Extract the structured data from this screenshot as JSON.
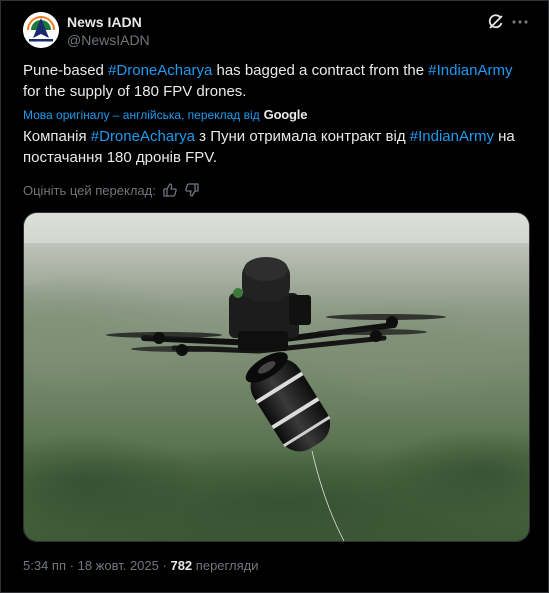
{
  "author": {
    "name": "News IADN",
    "handle": "@NewsIADN"
  },
  "icons": {
    "grok": "grok-icon",
    "more": "more-dots-icon",
    "thumb_up": "thumb-up-icon",
    "thumb_down": "thumb-down-icon"
  },
  "tweet": {
    "part1": "Pune-based ",
    "hashtag1": "#DroneAcharya",
    "part2": " has bagged a contract from the ",
    "hashtag2": "#IndianArmy",
    "part3": " for the supply of 180 FPV drones."
  },
  "translation": {
    "note": "Мова оригіналу – англійська, переклад від",
    "provider": "Google",
    "part1": "Компанія ",
    "hashtag1": "#DroneAcharya",
    "part2": " з Пуни отримала контракт від ",
    "hashtag2": "#IndianArmy",
    "part3": " на постачання 180 дронів FPV.",
    "rate_label": "Оцініть цей переклад:"
  },
  "meta": {
    "time": "5:34 пп",
    "separator": "·",
    "date": "18 жовт. 2025",
    "views_count": "782",
    "views_label": "перегляди"
  },
  "colors": {
    "background": "#000000",
    "text": "#e7e9ea",
    "muted": "#71767b",
    "link": "#1d9bf0",
    "border": "#2f3336"
  }
}
